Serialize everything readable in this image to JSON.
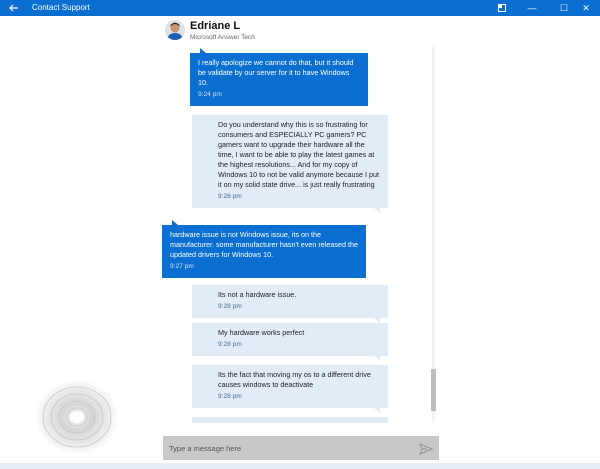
{
  "window": {
    "title": "Contact Support",
    "controls": {
      "minimize": "—",
      "maximize": "☐",
      "close": "✕"
    }
  },
  "agent": {
    "name": "Edriane L",
    "role": "Microsoft Answer Tech"
  },
  "messages": [
    {
      "from": "agent",
      "text": "I really apologize we cannot do that, but it should be validate by our server for it to have Windows 10.",
      "time": "9:24 pm"
    },
    {
      "from": "user",
      "text": "Do you understand why this is so frustrating for consumers and ESPECIALLY PC gamers? PC gamers want to upgrade their hardware all the time, I want to be able to play the latest games at the highest resolutions... And for my copy of Windows 10 to not be valid anymore because I put it on my solid state drive... is just really frustrating",
      "time": "9:26 pm"
    },
    {
      "from": "agent",
      "text": "hardware issue is not Windows issue, its on the manufacturer. some manufacturer hasn't even released the updated drivers for Windows 10.",
      "time": "9:27 pm"
    },
    {
      "from": "user",
      "text": "Its not a hardware issue.",
      "time": "9:28 pm"
    },
    {
      "from": "user",
      "text": "My hardware works perfect",
      "time": "9:28 pm"
    },
    {
      "from": "user",
      "text": "Its the fact that moving my os to a different drive causes windows to deactivate",
      "time": "9:28 pm"
    }
  ],
  "composer": {
    "placeholder": "Type a message here",
    "value": ""
  },
  "colors": {
    "accent": "#0a6fd0",
    "user_bubble": "#e2ecf7",
    "composer_bg": "#c8c8c8"
  },
  "icons": [
    "back-arrow-icon",
    "snap-icon",
    "minimize-icon",
    "maximize-icon",
    "close-icon",
    "send-icon"
  ]
}
